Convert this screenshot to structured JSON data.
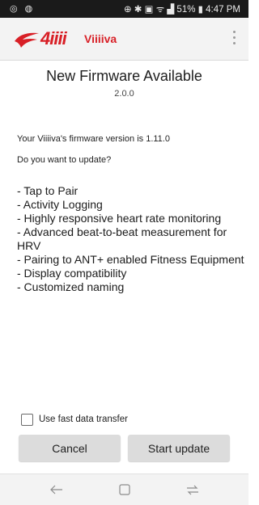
{
  "status_bar": {
    "left_icons": "◎ ◍",
    "right_text": "⊕ ✱ ▣ ᯤ ▟ 51% ▮ 4:47 PM"
  },
  "app_bar": {
    "logo_mark": "4iiii",
    "app_name": "Viiiiva",
    "menu_icon": "overflow-menu-icon",
    "brand_color": "#d81f26"
  },
  "dialog": {
    "title": "New Firmware Available",
    "new_version": "2.0.0",
    "current_version_text": "Your Viiiiva's firmware version is 1.11.0",
    "prompt": "Do you want to update?",
    "features": [
      "- Tap to Pair",
      "- Activity Logging",
      "- Highly responsive heart rate monitoring",
      "- Advanced beat-to-beat measurement for HRV",
      "- Pairing to ANT+ enabled Fitness Equipment",
      "- Display compatibility",
      "- Customized naming"
    ],
    "fast_transfer_label": "Use fast data transfer",
    "fast_transfer_checked": false,
    "cancel_label": "Cancel",
    "start_label": "Start update"
  },
  "nav_bar": {
    "icons": [
      "back-icon",
      "home-icon",
      "recents-icon"
    ]
  }
}
